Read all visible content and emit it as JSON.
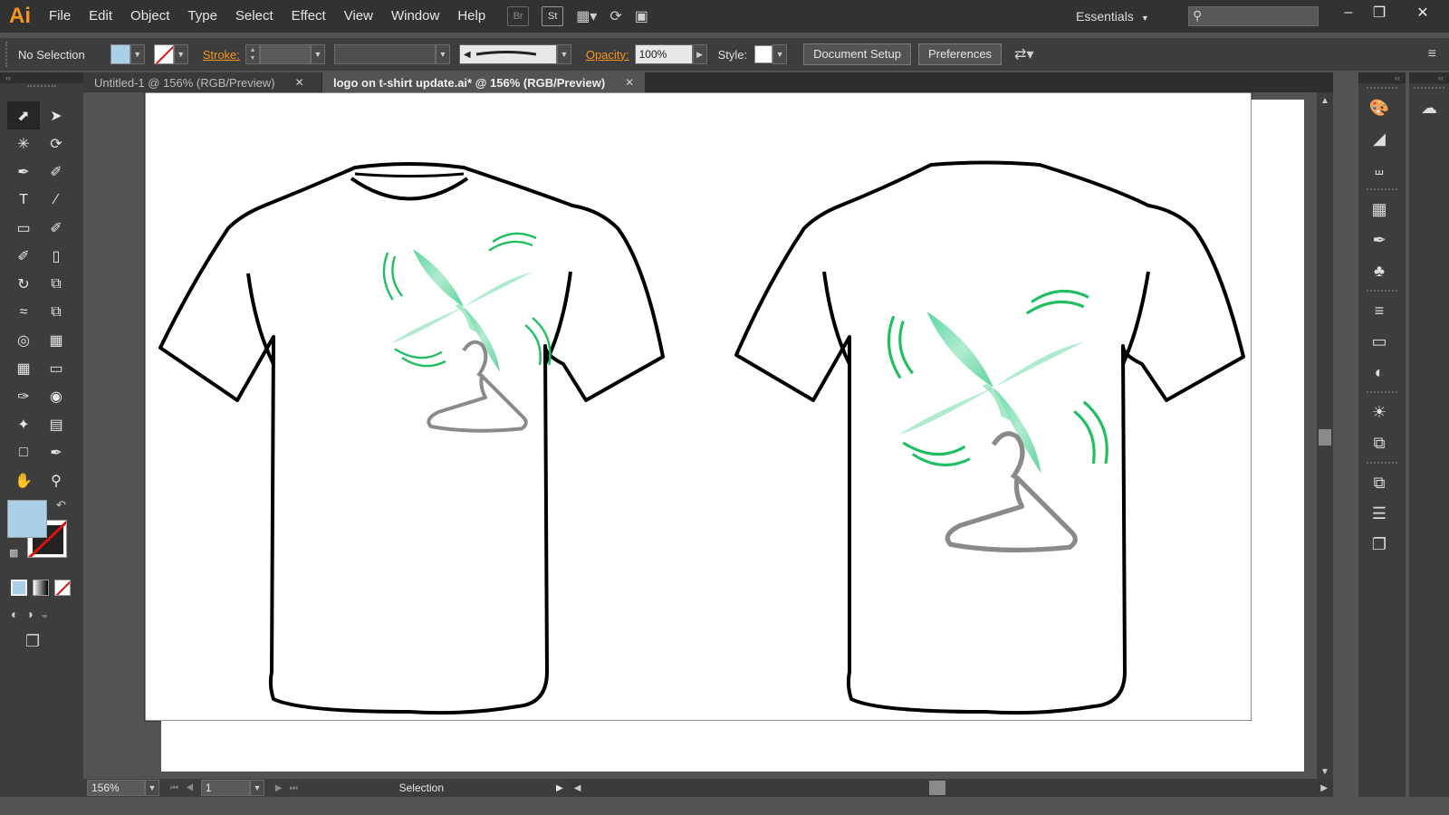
{
  "app": {
    "logo": "Ai"
  },
  "menu": [
    "File",
    "Edit",
    "Object",
    "Type",
    "Select",
    "Effect",
    "View",
    "Window",
    "Help"
  ],
  "menubar_icons": {
    "bridge": "Br",
    "stock": "St"
  },
  "workspace": "Essentials",
  "search": {
    "value": ""
  },
  "control": {
    "selection": "No Selection",
    "stroke_label": "Stroke:",
    "opacity_label": "Opacity:",
    "opacity_value": "100%",
    "style_label": "Style:",
    "doc_setup": "Document Setup",
    "preferences": "Preferences"
  },
  "tabs": [
    {
      "label": "Untitled-1 @ 156% (RGB/Preview)",
      "active": false
    },
    {
      "label": "logo on t-shirt update.ai* @ 156% (RGB/Preview)",
      "active": true
    }
  ],
  "status": {
    "zoom": "156%",
    "artboard": "1",
    "tool": "Selection"
  },
  "colors": {
    "fill": "#a9cfe9",
    "accent": "#f7941d",
    "logo_green": "#2ecc71",
    "logo_mint": "#7fdcab"
  },
  "tools": [
    [
      "selection-tool",
      "direct-selection-tool"
    ],
    [
      "magic-wand-tool",
      "lasso-tool"
    ],
    [
      "pen-tool",
      "curvature-tool"
    ],
    [
      "type-tool",
      "line-segment-tool"
    ],
    [
      "rectangle-tool",
      "paintbrush-tool"
    ],
    [
      "shaper-tool",
      "eraser-tool"
    ],
    [
      "rotate-tool",
      "scale-tool"
    ],
    [
      "width-tool",
      "free-transform-tool"
    ],
    [
      "shape-builder-tool",
      "perspective-grid-tool"
    ],
    [
      "mesh-tool",
      "gradient-tool"
    ],
    [
      "eyedropper-tool",
      "blend-tool"
    ],
    [
      "symbol-sprayer-tool",
      "column-graph-tool"
    ],
    [
      "artboard-tool",
      "slice-tool"
    ],
    [
      "hand-tool",
      "zoom-tool"
    ]
  ]
}
